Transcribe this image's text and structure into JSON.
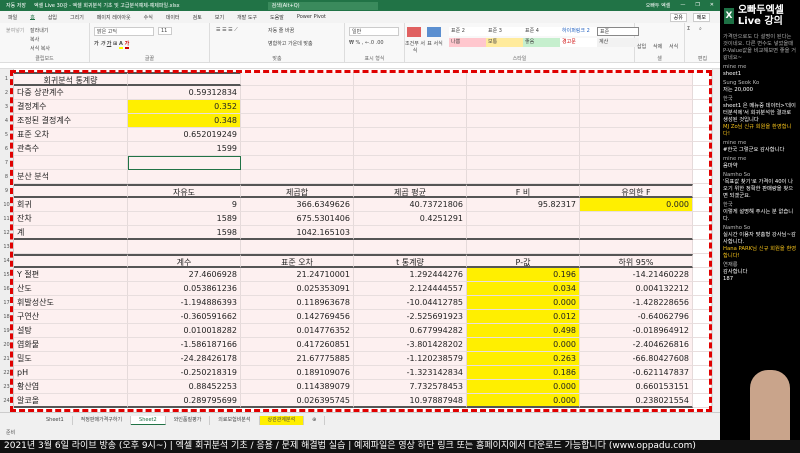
{
  "window": {
    "autosave": "자동 저장",
    "title": "엑셀 Live 30강 - 엑셀 회귀분석 기초 및 고급분석예제-예제파일.xlsx",
    "search": "검색(Alt+Q)",
    "user": "오빠두 엑셀"
  },
  "menu": [
    "파일",
    "홈",
    "삽입",
    "그리기",
    "페이지 레이아웃",
    "수식",
    "데이터",
    "검토",
    "보기",
    "개발 도구",
    "도움말",
    "Power Pivot"
  ],
  "share": [
    "공유",
    "메모"
  ],
  "ribbon": {
    "clipboard": {
      "label": "클립보드",
      "paste": "붙여넣기",
      "cut": "잘라내기",
      "copy": "복사",
      "format_painter": "서식 복사"
    },
    "font": {
      "label": "글꼴",
      "name": "맑은 고딕",
      "size": "11"
    },
    "align": {
      "label": "맞춤",
      "wrap": "자동 줄 바꿈",
      "merge": "병합하고 가운데 맞춤"
    },
    "number": {
      "label": "표시 형식",
      "format": "일반"
    },
    "styles": {
      "label": "스타일",
      "items": [
        {
          "name": "표준 2",
          "bg": "#ffffff"
        },
        {
          "name": "표준 3",
          "bg": "#ffffff"
        },
        {
          "name": "표준 4",
          "bg": "#ffffff"
        },
        {
          "name": "하이퍼링크 2",
          "bg": "#ffffff"
        },
        {
          "name": "표준",
          "bg": "#ffffff"
        },
        {
          "name": "나쁨",
          "bg": "#ffc7ce"
        },
        {
          "name": "보통",
          "bg": "#ffeb9c"
        },
        {
          "name": "좋음",
          "bg": "#c6efce"
        },
        {
          "name": "경고문",
          "bg": "#ffffff"
        },
        {
          "name": "계산",
          "bg": "#f2f2f2"
        }
      ],
      "cond": "조건부 서식",
      "table": "표 서식"
    },
    "cells": {
      "label": "셀",
      "insert": "삽입",
      "delete": "삭제",
      "format": "서식"
    },
    "edit": {
      "label": "편집",
      "autosum": "자동 합계",
      "fill": "채우기",
      "clear": "지우기",
      "sort": "정렬 및 필터",
      "find": "찾기 및 선택"
    }
  },
  "sheet": {
    "stats_title": "회귀분석 통계량",
    "stats": [
      [
        "다중 상관계수",
        "0.59312834",
        false
      ],
      [
        "결정계수",
        "0.352",
        true
      ],
      [
        "조정된 결정계수",
        "0.348",
        true
      ],
      [
        "표준 오차",
        "0.652019249",
        false
      ],
      [
        "관측수",
        "1599",
        false
      ]
    ],
    "anova_title": "분산 분석",
    "anova_headers": [
      "",
      "자유도",
      "제곱합",
      "제곱 평균",
      "F 비",
      "유의한 F"
    ],
    "anova": [
      [
        "회귀",
        "9",
        "366.6349626",
        "40.73721806",
        "95.82317",
        "0.000"
      ],
      [
        "잔차",
        "1589",
        "675.5301406",
        "0.4251291",
        "",
        ""
      ],
      [
        "계",
        "1598",
        "1042.165103",
        "",
        "",
        ""
      ]
    ],
    "coef_headers": [
      "",
      "계수",
      "표준 오차",
      "t 통계량",
      "P-값",
      "하위 95%"
    ],
    "coef": [
      [
        "Y 절편",
        "27.4606928",
        "21.24710001",
        "1.292444276",
        "0.196",
        "-14.21460228"
      ],
      [
        "산도",
        "0.053861236",
        "0.025353091",
        "2.124444557",
        "0.034",
        "0.004132212"
      ],
      [
        "휘발성산도",
        "-1.194886393",
        "0.118963678",
        "-10.04412785",
        "0.000",
        "-1.428228656"
      ],
      [
        "구연산",
        "-0.360591662",
        "0.142769456",
        "-2.525691923",
        "0.012",
        "-0.64062796"
      ],
      [
        "설탕",
        "0.010018282",
        "0.014776352",
        "0.677994282",
        "0.498",
        "-0.018964912"
      ],
      [
        "염화물",
        "-1.586187166",
        "0.417260851",
        "-3.801428202",
        "0.000",
        "-2.404626816"
      ],
      [
        "밀도",
        "-24.28426178",
        "21.67775885",
        "-1.120238579",
        "0.263",
        "-66.80427608"
      ],
      [
        "pH",
        "-0.250218319",
        "0.189109076",
        "-1.323142834",
        "0.186",
        "-0.621147837"
      ],
      [
        "황산염",
        "0.88452253",
        "0.114389079",
        "7.732578453",
        "0.000",
        "0.660153151"
      ],
      [
        "알코올",
        "0.289795699",
        "0.026395745",
        "10.97887948",
        "0.000",
        "0.238021554"
      ]
    ],
    "row_numbers": [
      "",
      "1",
      "2",
      "3",
      "4",
      "5",
      "6",
      "7",
      "8",
      "9",
      "10",
      "11",
      "12",
      "13",
      "14",
      "15",
      "16",
      "17",
      "18",
      "19",
      "20",
      "21",
      "22",
      "23",
      "24"
    ],
    "highlight": "#ffef00"
  },
  "tabs": [
    "Sheet1",
    "적정판매가격구하기",
    "Sheet2",
    "와인품질평가",
    "의료보험비분석",
    "상관관계분석"
  ],
  "status": "준비",
  "caption": "2021년 3월 6일 라이브 방송 (오후 9시~) | 엑셀 회귀분석 기초 / 응용 / 문제 해결법 실습 | 예제파일은 영상 하단 링크 또는 홈페이지에서 다운로드 가능합니다 (www.oppadu.com)",
  "panel": {
    "logo": "X",
    "title": "오빠두엑셀 Live 강의",
    "intro": "가격만으로도 다 설명이 된다는 것이네요. 다른 변수도 넣었을때 P-Value값을 비교해보면 좋을 거 같네요~",
    "chat": [
      {
        "user": "mine me",
        "msg": "sheet1"
      },
      {
        "user": "Sung Seok Ko",
        "msg": "저는 20,000"
      },
      {
        "user": "한국",
        "msg": "sheet1 은 메뉴중 데이터>'데이터분석에'서 회귀분석한 결과로 생성된 것입니다"
      },
      {
        "user": "",
        "msg": "MJ Zo님 신규 회원을 환영합니다!",
        "hi": true
      },
      {
        "user": "mine me",
        "msg": "#한국 그렇군요 감사합니다"
      },
      {
        "user": "mine me",
        "msg": "음마약"
      },
      {
        "user": "Namho So",
        "msg": "'목표값 찾기'로 가격이 40이 나오기 위한 정확한 판매량을 찾으면 되겠군요."
      },
      {
        "user": "한국",
        "msg": "이렇게 설명해 주시는 분 없습니다."
      },
      {
        "user": "Namho So",
        "msg": "실시간 이용자 맞춤형 강사님~감사합니다."
      },
      {
        "user": "",
        "msg": "Hana PARK님 신규 회원을 환영합니다!",
        "hi": true
      },
      {
        "user": "연재룡",
        "msg": "감사합니다"
      },
      {
        "user": "",
        "msg": "187"
      }
    ]
  }
}
